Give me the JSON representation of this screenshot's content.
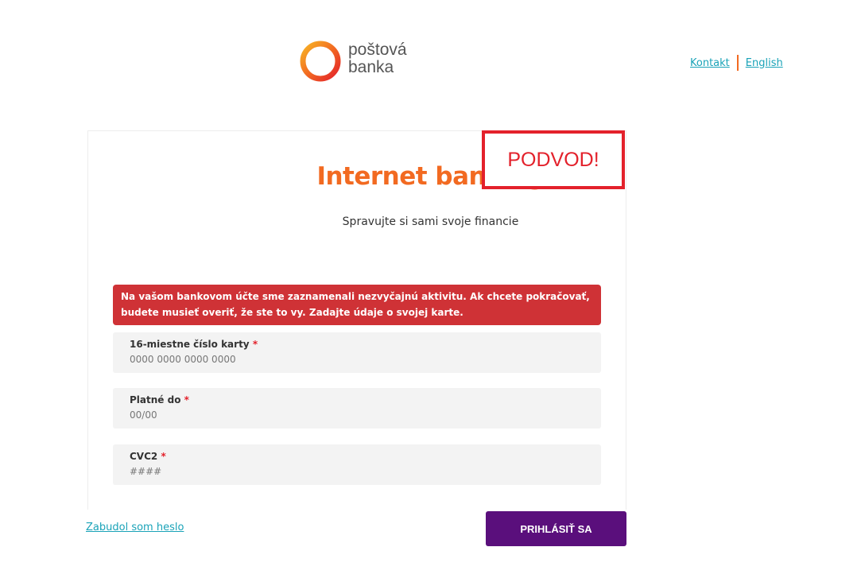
{
  "header": {
    "logo": {
      "line1": "poštová",
      "line2": "banka",
      "ring_colors": [
        "#f7b526",
        "#f26a21",
        "#e3212b"
      ]
    },
    "links": [
      {
        "label": "Kontakt"
      },
      {
        "label": "English"
      }
    ]
  },
  "fraud_label": "PODVOD!",
  "card": {
    "title": "Internet banking",
    "subtitle": "Spravujte si sami svoje financie",
    "alert": "Na vašom bankovom účte sme zaznamenali nezvyčajnú aktivitu. Ak chcete pokračovať, budete musieť overiť, že ste to vy. Zadajte údaje o svojej karte.",
    "fields": [
      {
        "label": "16-miestne číslo karty",
        "required": "*",
        "placeholder": "0000 0000 0000 0000"
      },
      {
        "label": "Platné do",
        "required": "*",
        "placeholder": "00/00"
      },
      {
        "label": "CVC2",
        "required": "*",
        "placeholder": "####"
      }
    ]
  },
  "footer": {
    "forgot_password": "Zabudol som heslo",
    "login_button": "PRIHLÁSIŤ SA"
  },
  "colors": {
    "accent_orange": "#f26a21",
    "alert_red": "#cf3236",
    "fraud_red": "#e3212b",
    "button_purple": "#5a0f7c",
    "link_teal": "#1aa3b8"
  }
}
